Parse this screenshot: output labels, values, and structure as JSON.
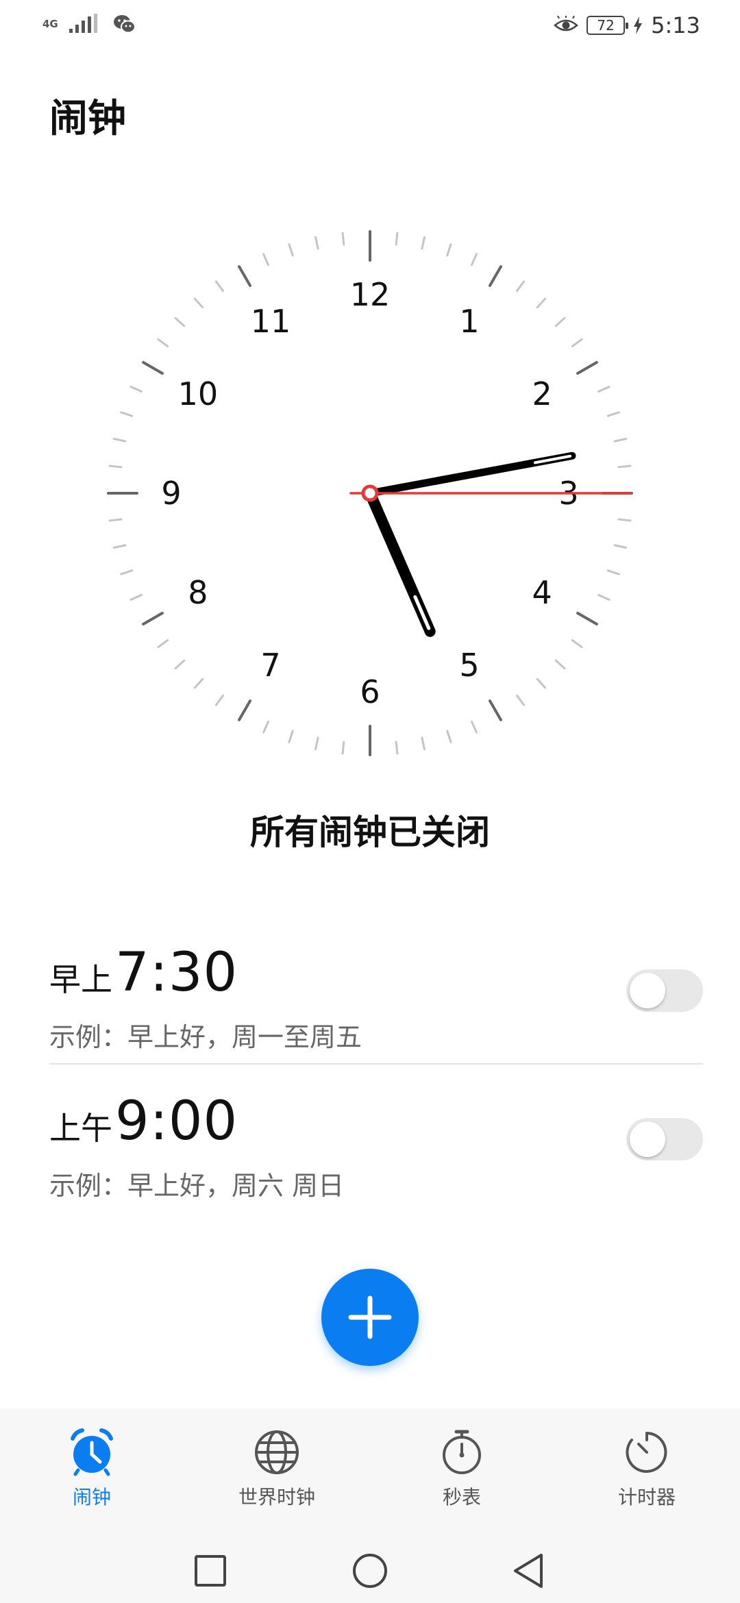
{
  "status_bar": {
    "network": "4G",
    "battery": "72",
    "time": "5:13",
    "icons": [
      "signal-icon",
      "wechat-icon",
      "eye-icon",
      "battery-icon",
      "charging-icon"
    ]
  },
  "title": "闹钟",
  "clock": {
    "numerals": [
      "12",
      "1",
      "2",
      "3",
      "4",
      "5",
      "6",
      "7",
      "8",
      "9",
      "10",
      "11"
    ],
    "time": {
      "hour": 5,
      "minute": 13,
      "second": 15
    },
    "second_hand_color": "#e53935"
  },
  "status_message": "所有闹钟已关闭",
  "alarms": [
    {
      "period": "早上",
      "time": "7:30",
      "label": "示例：早上好，周一至周五",
      "enabled": false
    },
    {
      "period": "上午",
      "time": "9:00",
      "label": "示例：早上好，周六 周日",
      "enabled": false
    }
  ],
  "fab": {
    "icon": "plus-icon",
    "color": "#0a7ef0"
  },
  "tabs": [
    {
      "label": "闹钟",
      "icon": "alarm-clock-icon",
      "active": true
    },
    {
      "label": "世界时钟",
      "icon": "globe-icon",
      "active": false
    },
    {
      "label": "秒表",
      "icon": "stopwatch-icon",
      "active": false
    },
    {
      "label": "计时器",
      "icon": "timer-icon",
      "active": false
    }
  ],
  "accent_color": "#0a7ef0",
  "nav": [
    "recents-square-icon",
    "home-circle-icon",
    "back-triangle-icon"
  ]
}
